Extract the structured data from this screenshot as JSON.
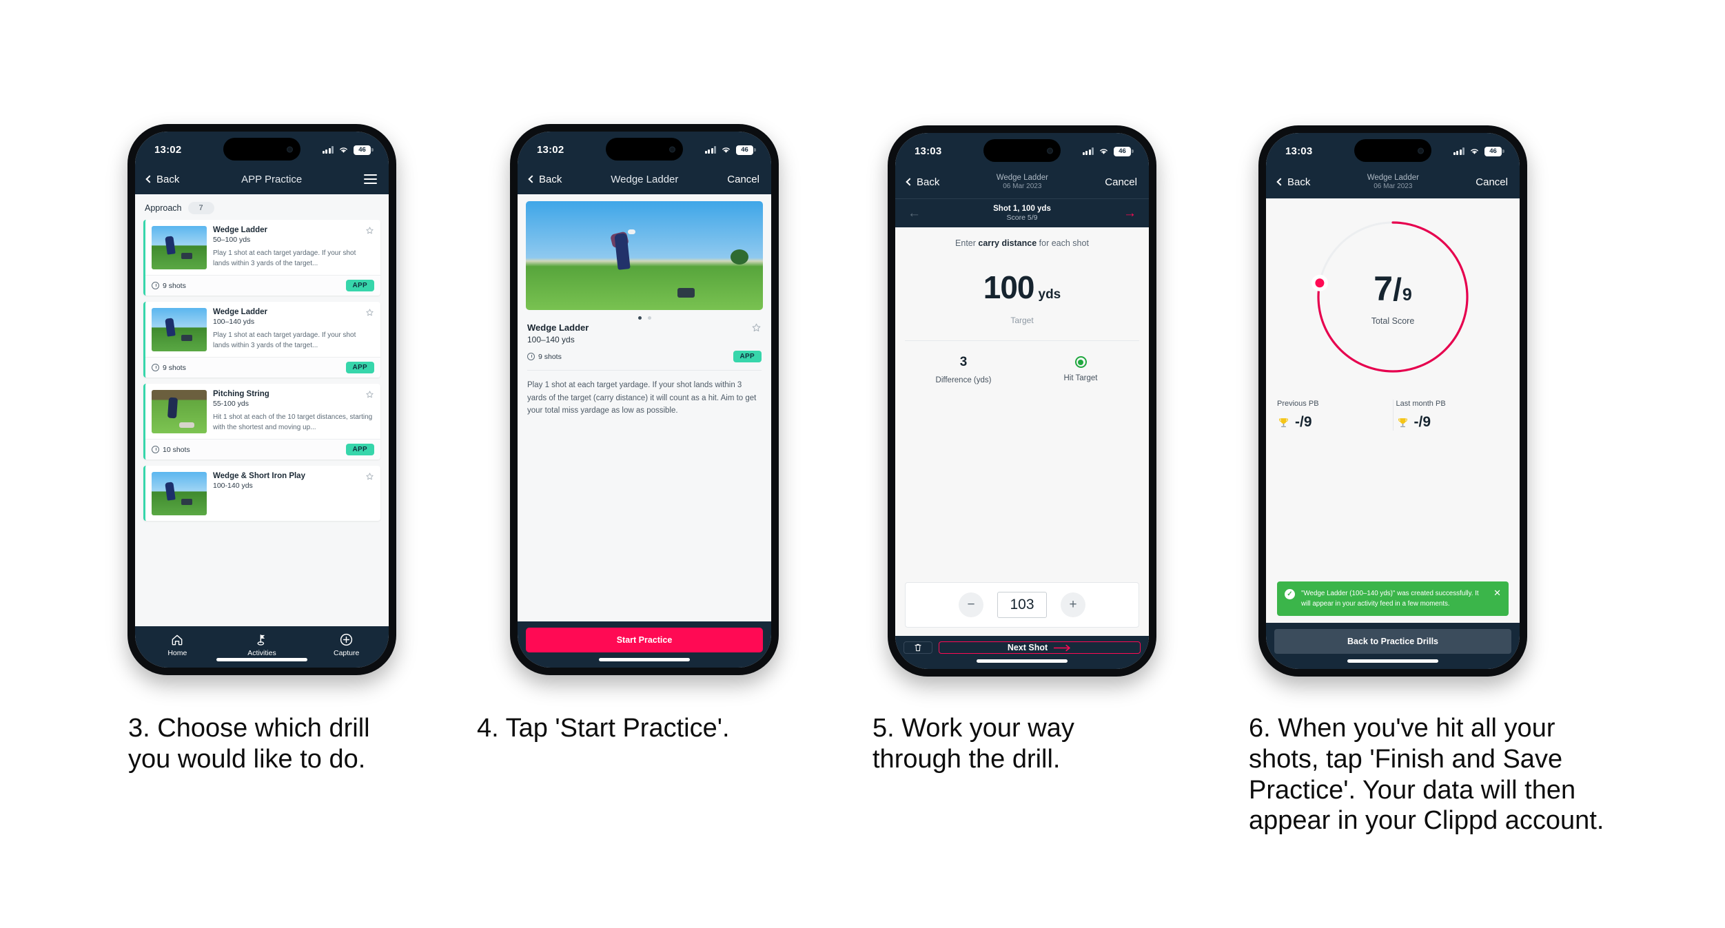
{
  "phones": [
    {
      "status": {
        "time": "13:02",
        "battery": "46"
      },
      "nav": {
        "back": "Back",
        "title": "APP Practice",
        "menu_icon": "hamburger-menu-icon"
      },
      "section": {
        "label": "Approach",
        "count": "7"
      },
      "cards": [
        {
          "title": "Wedge Ladder",
          "range": "50–100 yds",
          "desc": "Play 1 shot at each target yardage. If your shot lands within 3 yards of the target...",
          "shots": "9 shots",
          "badge": "APP"
        },
        {
          "title": "Wedge Ladder",
          "range": "100–140 yds",
          "desc": "Play 1 shot at each target yardage. If your shot lands within 3 yards of the target...",
          "shots": "9 shots",
          "badge": "APP"
        },
        {
          "title": "Pitching String",
          "range": "55-100 yds",
          "desc": "Hit 1 shot at each of the 10 target distances, starting with the shortest and moving up...",
          "shots": "10 shots",
          "badge": "APP"
        },
        {
          "title": "Wedge & Short Iron Play",
          "range": "100-140 yds",
          "desc": "",
          "shots": "",
          "badge": ""
        }
      ],
      "tabs": [
        {
          "label": "Home",
          "icon": "home-icon"
        },
        {
          "label": "Activities",
          "icon": "golf-flag-icon"
        },
        {
          "label": "Capture",
          "icon": "plus-circle-icon"
        }
      ]
    },
    {
      "status": {
        "time": "13:02",
        "battery": "46"
      },
      "nav": {
        "back": "Back",
        "title": "Wedge Ladder",
        "cancel": "Cancel"
      },
      "detail": {
        "title": "Wedge Ladder",
        "range": "100–140 yds",
        "shots": "9 shots",
        "badge": "APP",
        "desc": "Play 1 shot at each target yardage. If your shot lands within 3 yards of the target (carry distance) it will count as a hit. Aim to get your total miss yardage as low as possible."
      },
      "cta": "Start Practice"
    },
    {
      "status": {
        "time": "13:03",
        "battery": "46"
      },
      "nav": {
        "back": "Back",
        "title": "Wedge Ladder",
        "date": "06 Mar 2023",
        "cancel": "Cancel"
      },
      "shotbar": {
        "shot": "Shot 1, 100 yds",
        "score": "Score 5/9"
      },
      "prompt": {
        "pre": "Enter ",
        "bold": "carry distance",
        "post": " for each shot"
      },
      "target": {
        "value": "100",
        "unit": "yds",
        "caption": "Target"
      },
      "stats": [
        {
          "value": "3",
          "label": "Difference (yds)"
        },
        {
          "value": "",
          "label": "Hit Target"
        }
      ],
      "stepper": {
        "minus": "−",
        "value": "103",
        "plus": "+"
      },
      "footer": {
        "delete_icon": "trash-icon",
        "next": "Next Shot"
      }
    },
    {
      "status": {
        "time": "13:03",
        "battery": "46"
      },
      "nav": {
        "back": "Back",
        "title": "Wedge Ladder",
        "date": "06 Mar 2023",
        "cancel": "Cancel"
      },
      "score": {
        "made": "7",
        "slash": "/",
        "total": "9",
        "caption": "Total Score",
        "percent": 78
      },
      "pbs": [
        {
          "label": "Previous PB",
          "value": "-/9",
          "icon": "trophy-icon"
        },
        {
          "label": "Last month PB",
          "value": "-/9",
          "icon": "trophy-icon"
        }
      ],
      "toast": {
        "message": "\"Wedge Ladder (100–140 yds)\" was created successfully. It will appear in your activity feed in a few moments.",
        "close_icon": "close-icon"
      },
      "button": "Back to Practice Drills"
    }
  ],
  "captions": [
    "3. Choose which drill you would like to do.",
    "4. Tap 'Start Practice'.",
    "5. Work your way through the drill.",
    "6. When you've hit all your shots, tap 'Finish and Save Practice'. Your data will then appear in your Clippd account."
  ],
  "colors": {
    "navy": "#16293a",
    "pink": "#ff0a54",
    "teal": "#37d6ab",
    "green": "#3bb54a",
    "gold": "#f5c518"
  }
}
